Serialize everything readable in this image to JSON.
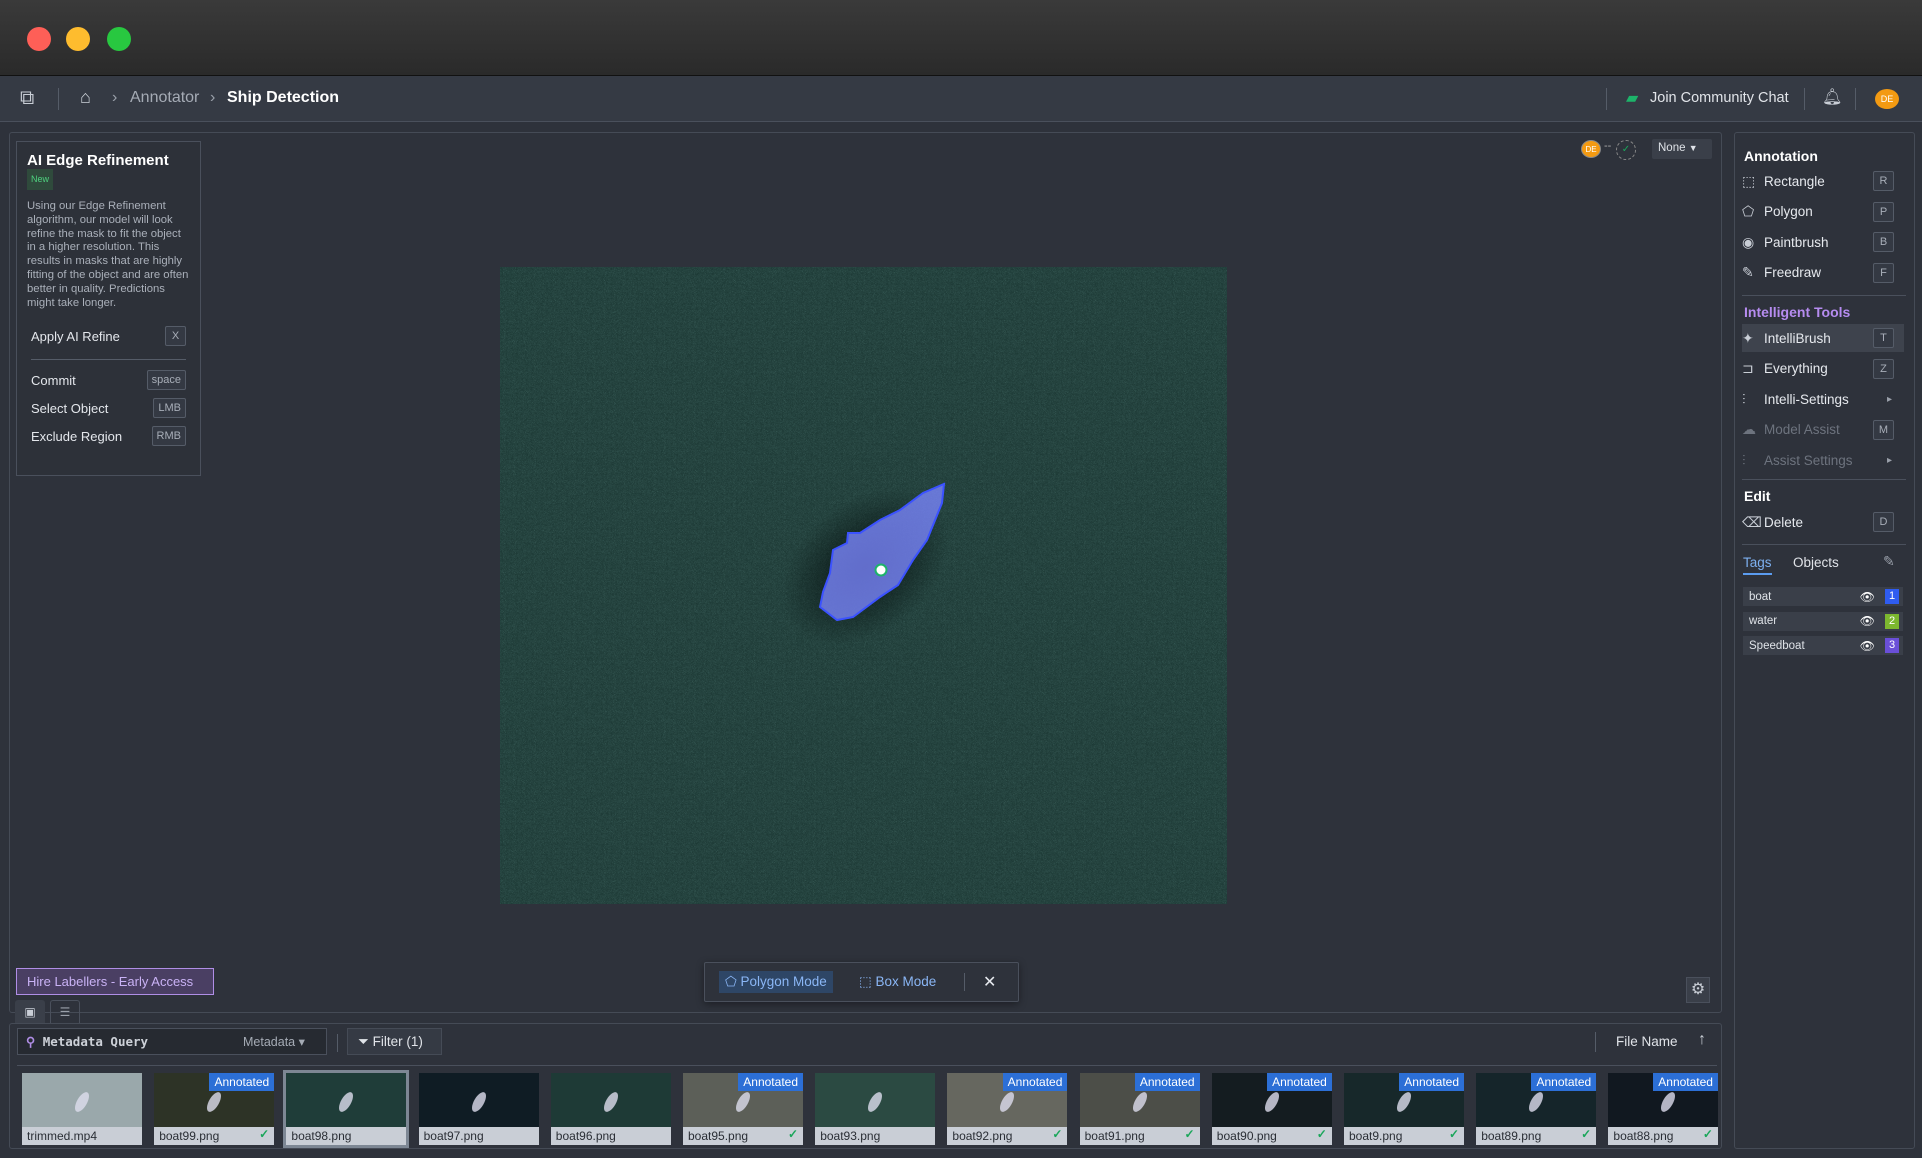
{
  "header": {
    "breadcrumb": [
      "Annotator",
      "Ship Detection"
    ],
    "community": "Join Community Chat",
    "avatar": "DE"
  },
  "ai_panel": {
    "title": "AI Edge Refinement",
    "badge": "New",
    "description": "Using our Edge Refinement algorithm, our model will look refine the mask to fit the object in a higher resolution. This results in masks that are highly fitting of the object and are often better in quality. Predictions might take longer.",
    "apply": {
      "label": "Apply AI Refine",
      "key": "X"
    },
    "shortcuts": [
      {
        "label": "Commit",
        "key": "space"
      },
      {
        "label": "Select Object",
        "key": "LMB"
      },
      {
        "label": "Exclude Region",
        "key": "RMB"
      }
    ]
  },
  "canvas": {
    "reviewer_avatar": "DE",
    "status_select": "None",
    "hire_button": "Hire Labellers - Early Access",
    "modes": {
      "polygon": "Polygon Mode",
      "box": "Box Mode"
    },
    "mask_color": "#7b86ff"
  },
  "right_panel": {
    "annotation_heading": "Annotation",
    "annotation": [
      {
        "label": "Rectangle",
        "key": "R",
        "icon": "rectangle-icon"
      },
      {
        "label": "Polygon",
        "key": "P",
        "icon": "polygon-icon"
      },
      {
        "label": "Paintbrush",
        "key": "B",
        "icon": "paintbrush-icon"
      },
      {
        "label": "Freedraw",
        "key": "F",
        "icon": "pencil-icon"
      }
    ],
    "intelligent_heading": "Intelligent Tools",
    "intelligent": [
      {
        "label": "IntelliBrush",
        "key": "T",
        "active": true
      },
      {
        "label": "Everything",
        "key": "Z"
      },
      {
        "label": "Intelli-Settings",
        "key": "▸"
      },
      {
        "label": "Model Assist",
        "key": "M",
        "disabled": true
      },
      {
        "label": "Assist Settings",
        "key": "▸",
        "disabled": true
      }
    ],
    "edit_heading": "Edit",
    "delete": {
      "label": "Delete",
      "key": "D"
    },
    "tabs": [
      "Tags",
      "Objects"
    ],
    "tags": [
      {
        "name": "boat",
        "num": "1",
        "color": "#2f5cf0"
      },
      {
        "name": "water",
        "num": "2",
        "color": "#7cb82f"
      },
      {
        "name": "Speedboat",
        "num": "3",
        "color": "#6a4fd8"
      }
    ]
  },
  "bottom": {
    "search_placeholder": "Metadata Query",
    "search_type": "Metadata",
    "filter": "Filter (1)",
    "sort": "File Name",
    "annotated_label": "Annotated",
    "files": [
      {
        "name": "trimmed.mp4",
        "annotated": false,
        "bg": "#9aa8ab"
      },
      {
        "name": "boat99.png",
        "annotated": true,
        "bg": "#2d3326"
      },
      {
        "name": "boat98.png",
        "annotated": false,
        "bg": "#1f3d39",
        "selected": true
      },
      {
        "name": "boat97.png",
        "annotated": false,
        "bg": "#0f1c24"
      },
      {
        "name": "boat96.png",
        "annotated": false,
        "bg": "#1e3a36"
      },
      {
        "name": "boat95.png",
        "annotated": true,
        "bg": "#5c5f58"
      },
      {
        "name": "boat93.png",
        "annotated": false,
        "bg": "#2b4a42"
      },
      {
        "name": "boat92.png",
        "annotated": true,
        "bg": "#66675f"
      },
      {
        "name": "boat91.png",
        "annotated": true,
        "bg": "#4c4e48"
      },
      {
        "name": "boat90.png",
        "annotated": true,
        "bg": "#141c20"
      },
      {
        "name": "boat9.png",
        "annotated": true,
        "bg": "#17282a"
      },
      {
        "name": "boat89.png",
        "annotated": true,
        "bg": "#15252a"
      },
      {
        "name": "boat88.png",
        "annotated": true,
        "bg": "#111820"
      }
    ]
  }
}
